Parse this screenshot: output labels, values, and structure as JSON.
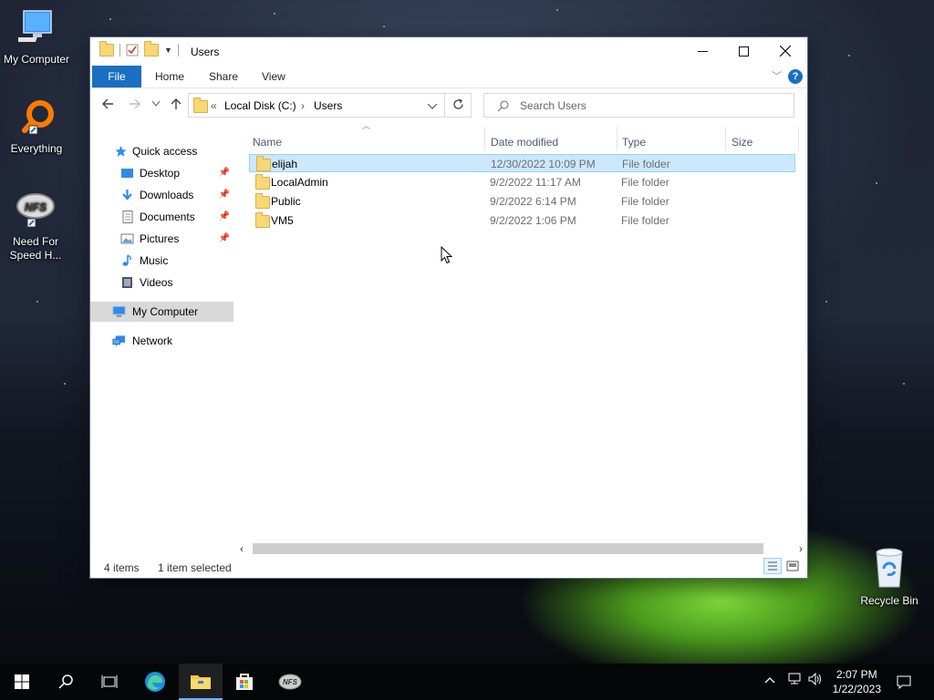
{
  "desktop": {
    "icons": [
      {
        "label": "My Computer"
      },
      {
        "label": "Everything"
      },
      {
        "label": "Need For Speed H..."
      },
      {
        "label": "Recycle Bin"
      }
    ]
  },
  "window": {
    "title": "Users",
    "ribbon_tabs": [
      "File",
      "Home",
      "Share",
      "View"
    ],
    "help_label": "?",
    "address": {
      "overflow": "«",
      "segments": [
        "Local Disk (C:)",
        "Users"
      ]
    },
    "search_placeholder": "Search Users",
    "nav_pane": {
      "quick_access": "Quick access",
      "items": [
        "Desktop",
        "Downloads",
        "Documents",
        "Pictures",
        "Music",
        "Videos"
      ],
      "my_computer": "My Computer",
      "network": "Network"
    },
    "columns": [
      "Name",
      "Date modified",
      "Type",
      "Size"
    ],
    "files": [
      {
        "name": "elijah",
        "date": "12/30/2022 10:09 PM",
        "type": "File folder",
        "size": "",
        "selected": true
      },
      {
        "name": "LocalAdmin",
        "date": "9/2/2022 11:17 AM",
        "type": "File folder",
        "size": "",
        "selected": false
      },
      {
        "name": "Public",
        "date": "9/2/2022 6:14 PM",
        "type": "File folder",
        "size": "",
        "selected": false
      },
      {
        "name": "VM5",
        "date": "9/2/2022 1:06 PM",
        "type": "File folder",
        "size": "",
        "selected": false
      }
    ],
    "status": {
      "items": "4 items",
      "selected": "1 item selected"
    }
  },
  "taskbar": {
    "time": "2:07 PM",
    "date": "1/22/2023"
  },
  "colors": {
    "accent": "#1a6fc2",
    "selection": "#cce8ff",
    "folder": "#f8d775"
  }
}
